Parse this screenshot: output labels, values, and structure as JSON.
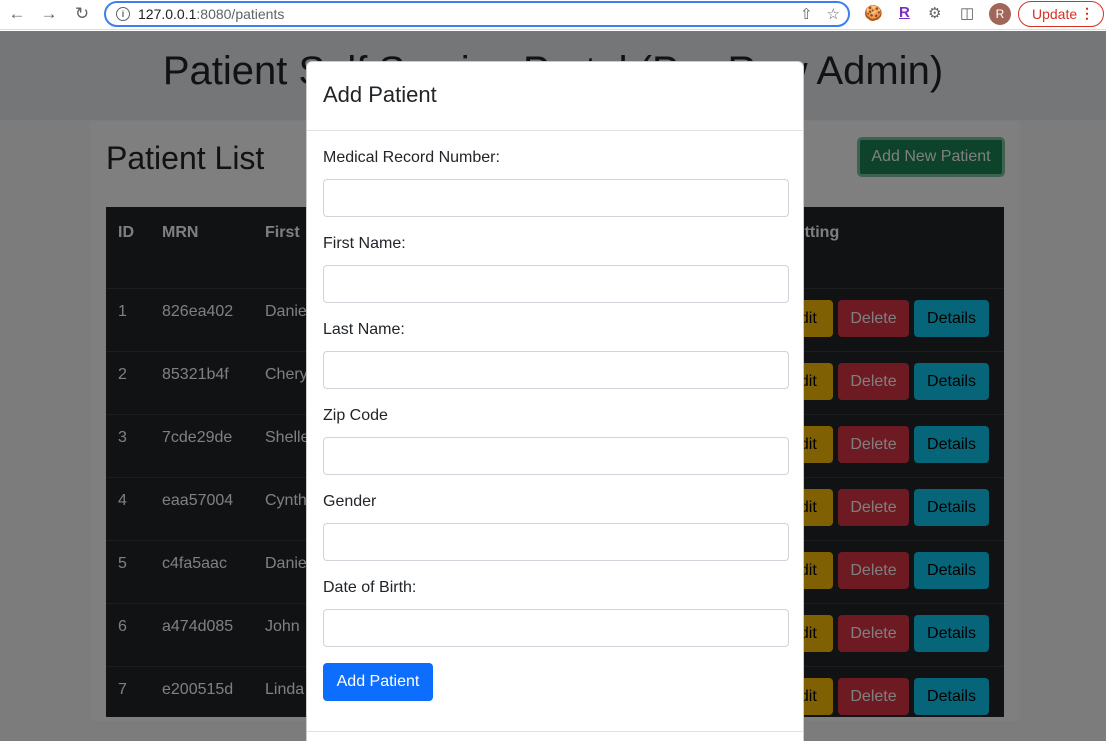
{
  "browser": {
    "url_host": "127.0.0.1",
    "url_rest": ":8080/patients",
    "profile_initial": "R",
    "update_label": "Update",
    "extension_r": "R"
  },
  "page": {
    "title": "Patient Self Service Portal (Per-Row Admin)",
    "list_title": "Patient List",
    "add_new_button": "Add New Patient",
    "table": {
      "headers": [
        "ID",
        "MRN",
        "First",
        "Setting"
      ],
      "rows": [
        {
          "id": "1",
          "mrn": "826ea402",
          "first": "Danie"
        },
        {
          "id": "2",
          "mrn": "85321b4f",
          "first": "Chery"
        },
        {
          "id": "3",
          "mrn": "7cde29de",
          "first": "Shelle"
        },
        {
          "id": "4",
          "mrn": "eaa57004",
          "first": "Cynth"
        },
        {
          "id": "5",
          "mrn": "c4fa5aac",
          "first": "Danie"
        },
        {
          "id": "6",
          "mrn": "a474d085",
          "first": "John"
        },
        {
          "id": "7",
          "mrn": "e200515d",
          "first": "Linda"
        }
      ],
      "edit_label": "Edit",
      "delete_label": "Delete",
      "details_label": "Details"
    }
  },
  "modal": {
    "title": "Add Patient",
    "fields": [
      {
        "label": "Medical Record Number:",
        "value": ""
      },
      {
        "label": "First Name:",
        "value": ""
      },
      {
        "label": "Last Name:",
        "value": ""
      },
      {
        "label": "Zip Code",
        "value": ""
      },
      {
        "label": "Gender",
        "value": ""
      },
      {
        "label": "Date of Birth:",
        "value": ""
      }
    ],
    "submit_label": "Add Patient"
  },
  "colors": {
    "primary": "#0d6efd",
    "success": "#198754",
    "warning": "#ffc107",
    "danger": "#dc3545",
    "info": "#0dcaf0",
    "table_dark": "#212529"
  }
}
